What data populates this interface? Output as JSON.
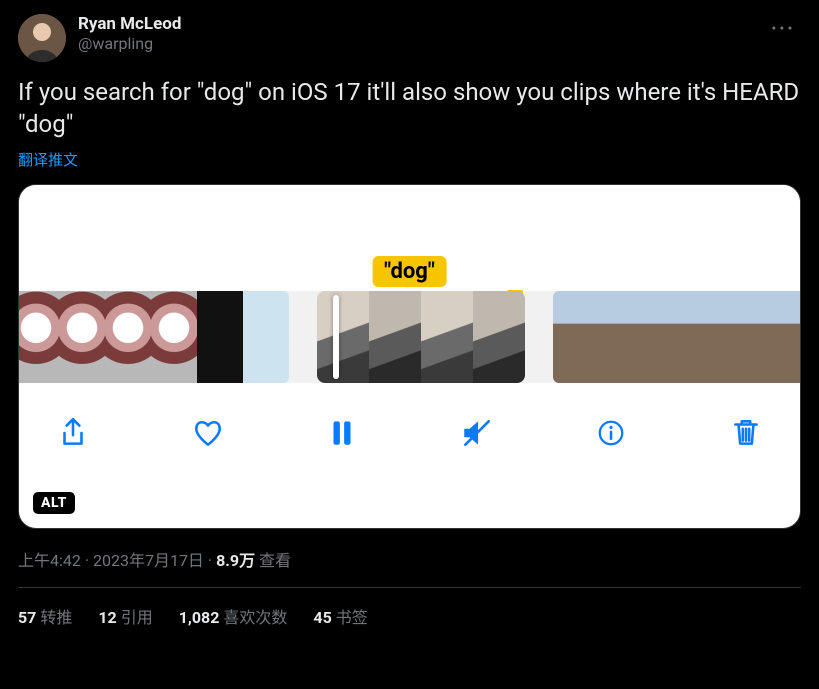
{
  "author": {
    "display_name": "Ryan McLeod",
    "handle": "@warpling"
  },
  "content": {
    "text": "If you search for \"dog\" on iOS 17 it'll also show you clips where it's HEARD \"dog\"",
    "translate_label": "翻译推文"
  },
  "media": {
    "search_term_label": "\"dog\"",
    "alt_badge": "ALT"
  },
  "meta": {
    "time": "上午4:42",
    "date": "2023年7月17日",
    "views_number": "8.9万",
    "views_label": "查看"
  },
  "stats": {
    "retweets_count": "57",
    "retweets_label": "转推",
    "quotes_count": "12",
    "quotes_label": "引用",
    "likes_count": "1,082",
    "likes_label": "喜欢次数",
    "bookmarks_count": "45",
    "bookmarks_label": "书签"
  }
}
